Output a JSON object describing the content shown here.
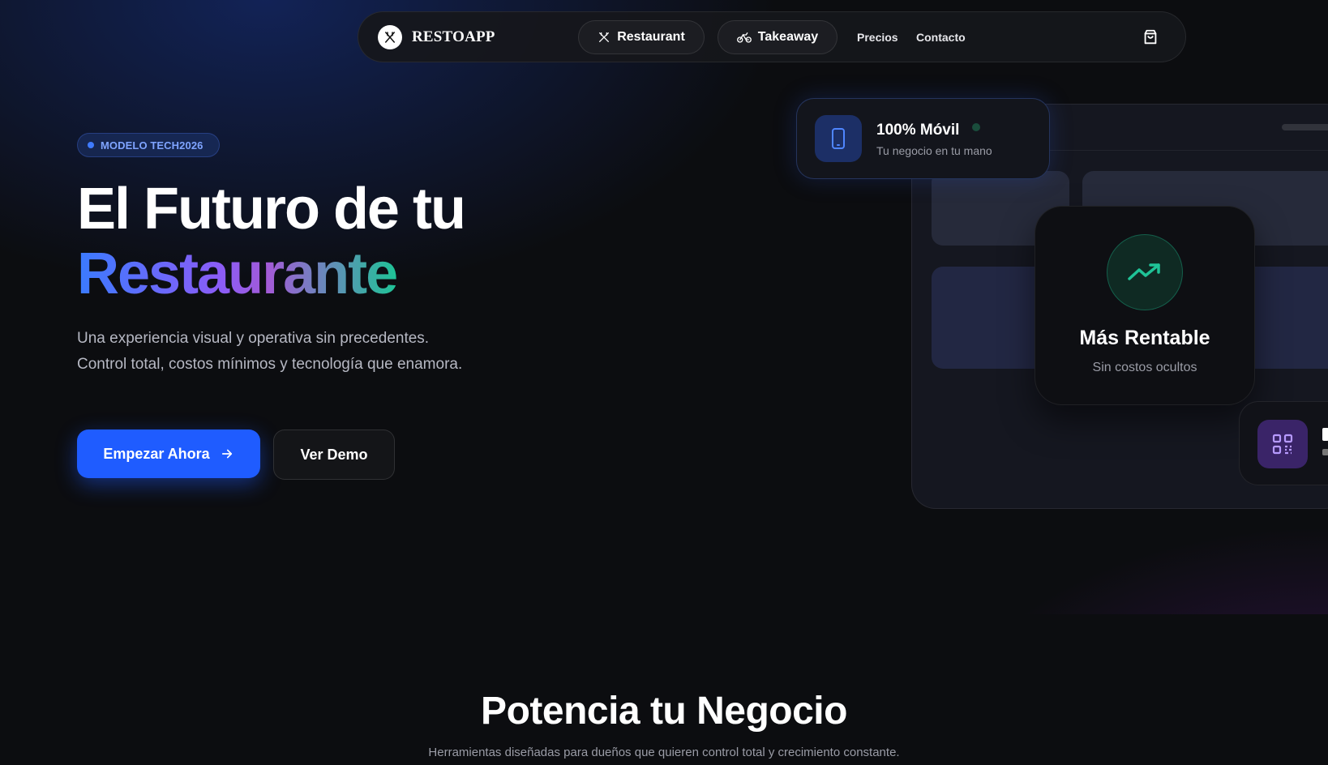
{
  "nav": {
    "brand": "RESTOAPP",
    "pill_restaurant": "Restaurant",
    "pill_takeaway": "Takeaway",
    "link_precios": "Precios",
    "link_contacto": "Contacto",
    "icons": [
      "utensils-icon",
      "bike-icon",
      "shopping-bag-icon"
    ]
  },
  "hero": {
    "badge": "MODELO TECH2026",
    "title_line1": "El Futuro de tu",
    "title_line2": "Restaurante",
    "description": "Una experiencia visual y operativa sin precedentes. Control total, costos mínimos y tecnología que enamora.",
    "cta_primary": "Empezar Ahora",
    "cta_secondary": "Ver Demo"
  },
  "cards": {
    "movil_title": "100% Móvil",
    "movil_sub": "Tu negocio en tu mano",
    "rentable_title": "Más Rentable",
    "rentable_sub": "Sin costos ocultos"
  },
  "section": {
    "title": "Potencia tu Negocio",
    "subtitle": "Herramientas diseñadas para dueños que quieren control total y crecimiento constante."
  },
  "colors": {
    "primary": "#1f5cff",
    "accent_green": "#1fc397",
    "accent_purple": "#8b5cf6",
    "background": "#0c0d10"
  }
}
